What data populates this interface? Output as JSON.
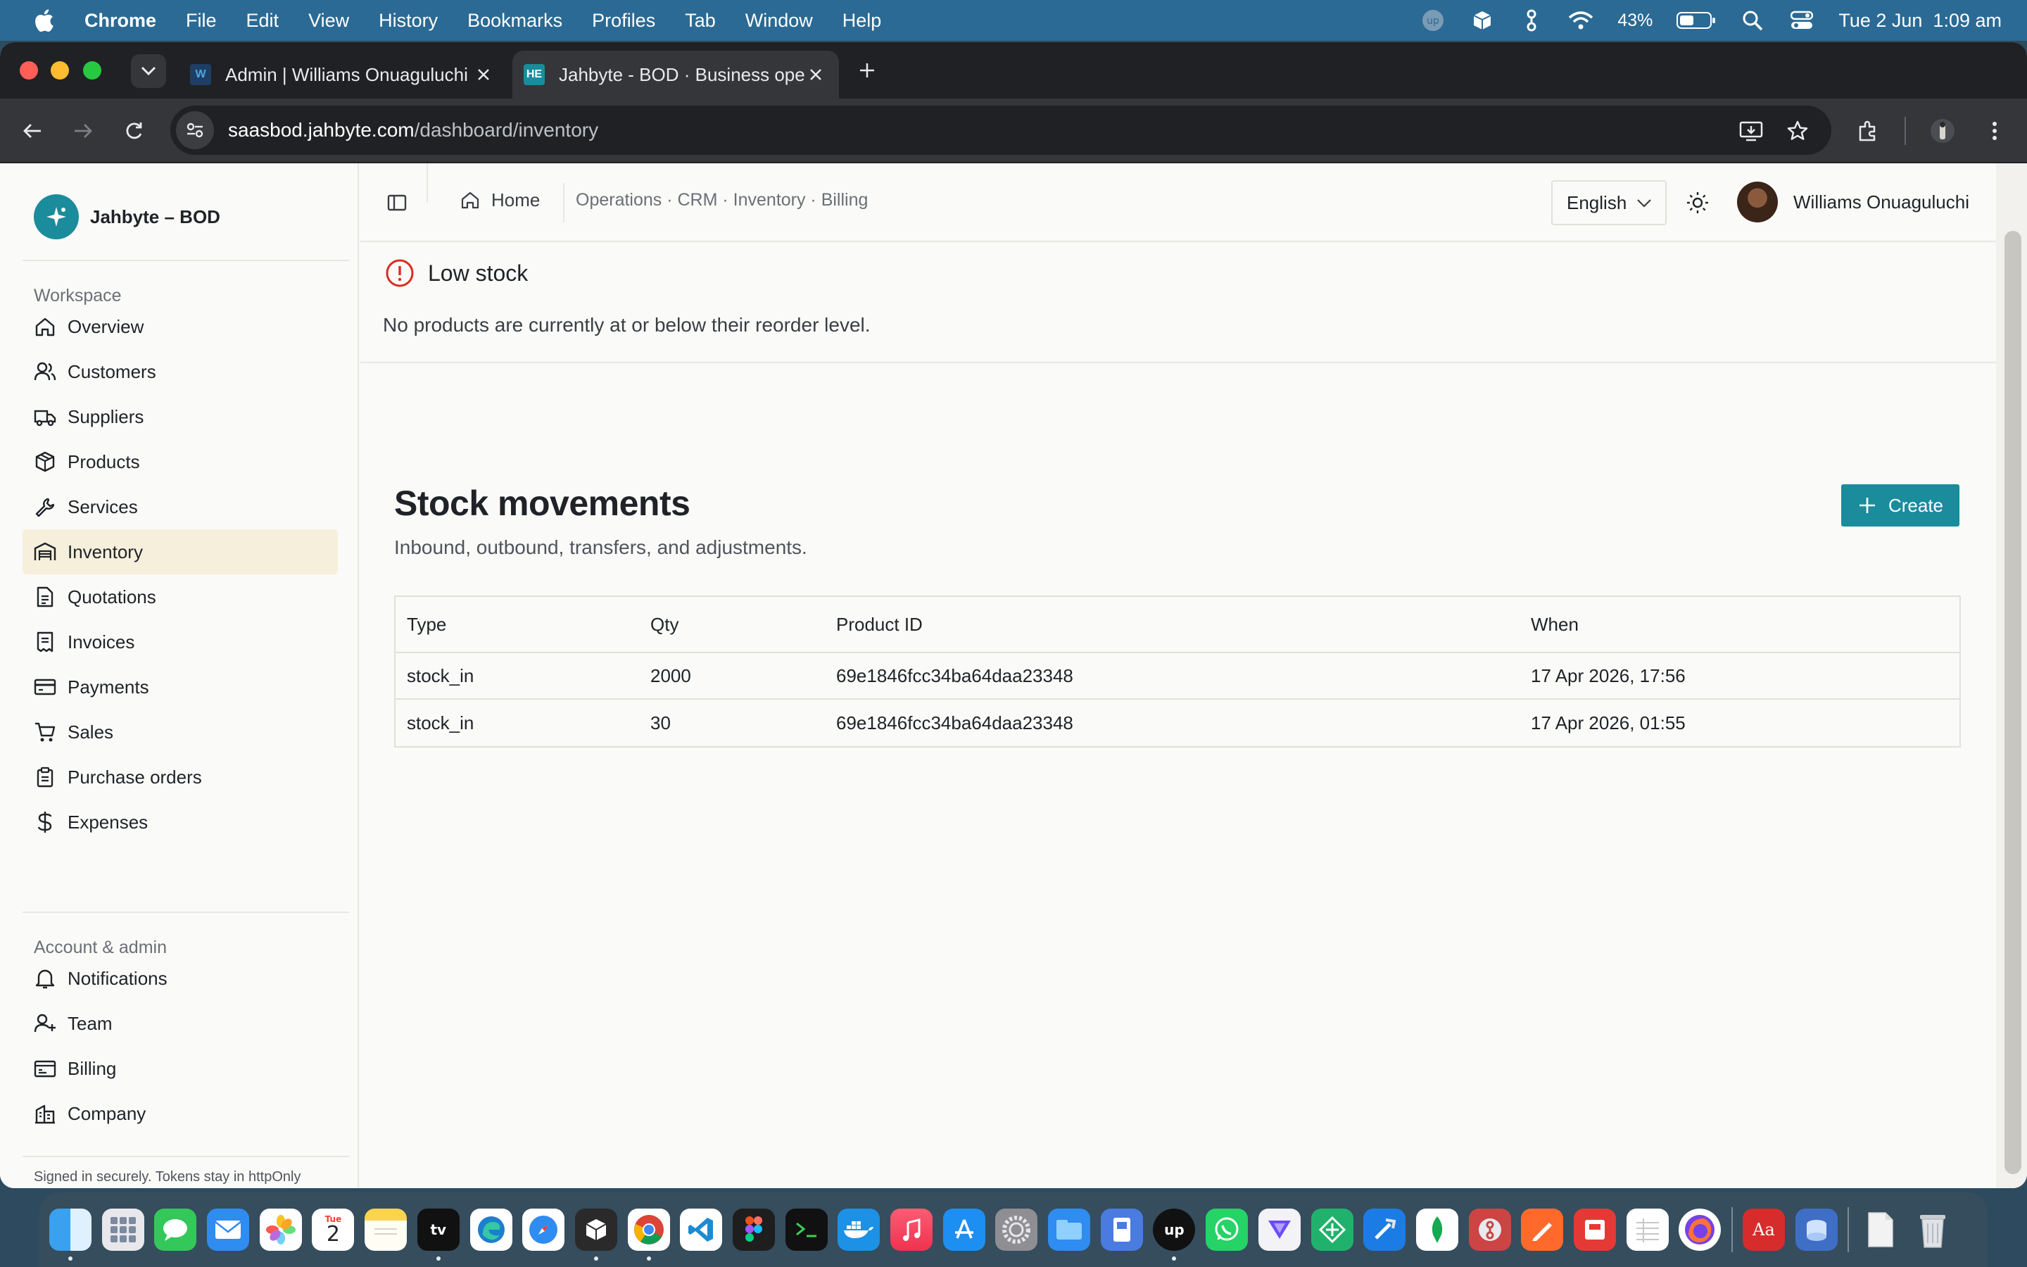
{
  "menubar": {
    "app": "Chrome",
    "items": [
      "File",
      "Edit",
      "View",
      "History",
      "Bookmarks",
      "Profiles",
      "Tab",
      "Window",
      "Help"
    ],
    "battery": "43%",
    "datetime": "Tue 2 Jun  1:09 am"
  },
  "browser": {
    "tabs": [
      {
        "title": "Admin | Williams Onuaguluchi",
        "favicon": "W"
      },
      {
        "title": "Jahbyte - BOD · Business ope",
        "favicon": "HE"
      }
    ],
    "url_host": "saasbod.jahbyte.com",
    "url_path": "/dashboard/inventory"
  },
  "sidebar": {
    "brand": "Jahbyte – BOD",
    "workspace_label": "Workspace",
    "workspace_items": [
      {
        "label": "Overview",
        "icon": "home-icon"
      },
      {
        "label": "Customers",
        "icon": "users-icon"
      },
      {
        "label": "Suppliers",
        "icon": "truck-icon"
      },
      {
        "label": "Products",
        "icon": "package-icon"
      },
      {
        "label": "Services",
        "icon": "wrench-icon"
      },
      {
        "label": "Inventory",
        "icon": "warehouse-icon",
        "active": true
      },
      {
        "label": "Quotations",
        "icon": "file-text-icon"
      },
      {
        "label": "Invoices",
        "icon": "receipt-icon"
      },
      {
        "label": "Payments",
        "icon": "credit-card-icon"
      },
      {
        "label": "Sales",
        "icon": "cart-icon"
      },
      {
        "label": "Purchase orders",
        "icon": "clipboard-icon"
      },
      {
        "label": "Expenses",
        "icon": "dollar-icon"
      }
    ],
    "admin_label": "Account & admin",
    "admin_items": [
      {
        "label": "Notifications",
        "icon": "bell-icon"
      },
      {
        "label": "Team",
        "icon": "user-plus-icon"
      },
      {
        "label": "Billing",
        "icon": "wallet-icon"
      },
      {
        "label": "Company",
        "icon": "building-icon"
      }
    ],
    "footer": "Signed in securely. Tokens stay in httpOnly cookies."
  },
  "topbar": {
    "home": "Home",
    "path": "Operations · CRM · Inventory · Billing",
    "language": "English",
    "user_name": "Williams Onuaguluchi"
  },
  "low_stock": {
    "title": "Low stock",
    "message": "No products are currently at or below their reorder level."
  },
  "stock_movements": {
    "title": "Stock movements",
    "subtitle": "Inbound, outbound, transfers, and adjustments.",
    "create_label": "Create",
    "columns": [
      "Type",
      "Qty",
      "Product ID",
      "When"
    ],
    "rows": [
      [
        "stock_in",
        "2000",
        "69e1846fcc34ba64daa23348",
        "17 Apr 2026, 17:56"
      ],
      [
        "stock_in",
        "30",
        "69e1846fcc34ba64daa23348",
        "17 Apr 2026, 01:55"
      ]
    ]
  },
  "dock": {
    "apps": [
      "finder-icon",
      "launchpad-icon",
      "messages-icon",
      "mail-icon",
      "photos-icon",
      "calendar-icon",
      "notes-icon",
      "apple-tv-icon",
      "edge-icon",
      "safari-icon",
      "cube-app-icon",
      "chrome-icon",
      "vscode-icon",
      "figma-icon",
      "terminal-icon",
      "docker-icon",
      "music-icon",
      "app-store-icon",
      "system-settings-icon",
      "files-icon",
      "preview-icon",
      "upwork-icon",
      "whatsapp-icon",
      "vpn-icon",
      "grid-app-icon",
      "xcode-icon",
      "mongodb-icon",
      "git-icon",
      "pen-icon",
      "archive-icon",
      "sheet-icon",
      "firefox-icon",
      "dictionary-icon",
      "disk-icon",
      "document-icon",
      "trash-icon"
    ],
    "calendar_day": "2",
    "calendar_month": "Tue",
    "apple_tv_label": "tv",
    "dictionary_label": "Aa"
  },
  "colors": {
    "accent": "#1a8c9c",
    "active_nav": "#f6efdb",
    "warning": "#d92d20"
  }
}
